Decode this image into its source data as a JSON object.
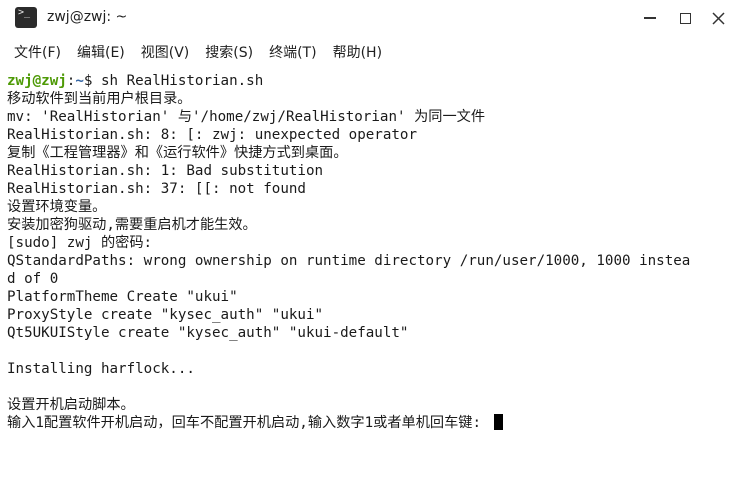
{
  "window": {
    "title": "zwj@zwj: ~",
    "icon": "terminal-icon"
  },
  "menu": {
    "items": [
      {
        "label": "文件(F)"
      },
      {
        "label": "编辑(E)"
      },
      {
        "label": "视图(V)"
      },
      {
        "label": "搜索(S)"
      },
      {
        "label": "终端(T)"
      },
      {
        "label": "帮助(H)"
      }
    ]
  },
  "terminal": {
    "prompt_user": "zwj@zwj",
    "prompt_sep": ":",
    "prompt_path": "~",
    "prompt_command": "$ sh RealHistorian.sh",
    "lines": [
      "移动软件到当前用户根目录。",
      "mv: 'RealHistorian' 与'/home/zwj/RealHistorian' 为同一文件",
      "RealHistorian.sh: 8: [: zwj: unexpected operator",
      "复制《工程管理器》和《运行软件》快捷方式到桌面。",
      "RealHistorian.sh: 1: Bad substitution",
      "RealHistorian.sh: 37: [[: not found",
      "设置环境变量。",
      "安装加密狗驱动,需要重启机才能生效。",
      "[sudo] zwj 的密码:",
      "QStandardPaths: wrong ownership on runtime directory /run/user/1000, 1000 instea",
      "d of 0",
      "PlatformTheme Create \"ukui\"",
      "ProxyStyle create \"kysec_auth\" \"ukui\"",
      "Qt5UKUIStyle create \"kysec_auth\" \"ukui-default\"",
      "",
      "Installing harflock...",
      "",
      "设置开机启动脚本。"
    ],
    "input_prompt": "输入1配置软件开机启动，回车不配置开机启动,输入数字1或者单机回车键: "
  },
  "colors": {
    "prompt_user": "#4e9a06",
    "prompt_path": "#3465a4",
    "background": "#ffffff",
    "text": "#1a1a1a"
  }
}
